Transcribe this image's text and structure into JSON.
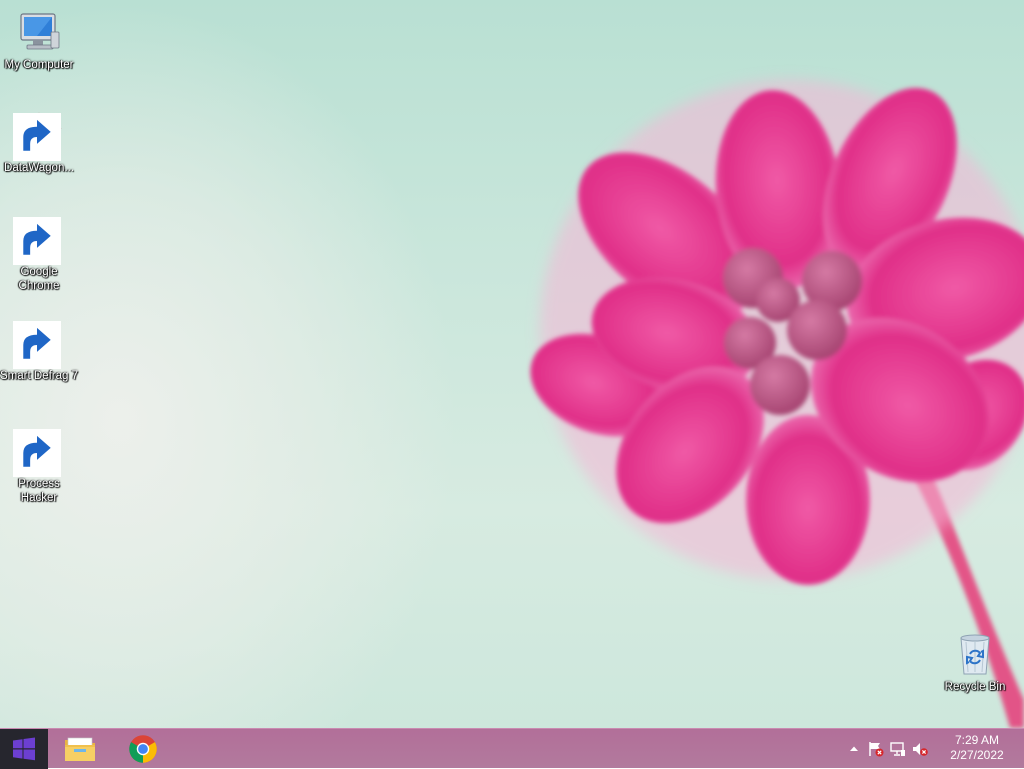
{
  "desktop": {
    "icons": [
      {
        "label": "My Computer",
        "icon": "computer-icon"
      },
      {
        "label": "DataWagon...",
        "icon": "datawagon-icon"
      },
      {
        "label": "Google Chrome",
        "icon": "chrome-icon"
      },
      {
        "label": "Smart Defrag 7",
        "icon": "smart-defrag-icon"
      },
      {
        "label": "Process Hacker",
        "icon": "process-hacker-icon"
      },
      {
        "label": "Recycle Bin",
        "icon": "recycle-bin-icon"
      }
    ]
  },
  "taskbar": {
    "start_icon": "windows-logo-icon",
    "pinned": [
      {
        "icon": "file-explorer-icon"
      },
      {
        "icon": "chrome-icon"
      }
    ],
    "tray": {
      "icons": [
        "show-hidden-icons-chevron",
        "action-center-flag-icon",
        "network-icon",
        "volume-muted-icon"
      ],
      "time": "7:29 AM",
      "date": "2/27/2022"
    }
  },
  "colors": {
    "taskbar": "#b27a9d",
    "start_button": "#26262e",
    "windows_logo": "#6c3fd1",
    "flower": "#e23a8c"
  }
}
